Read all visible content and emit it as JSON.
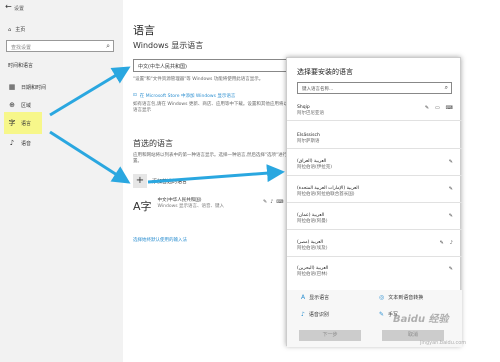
{
  "sidebar": {
    "back_glyph": "←",
    "window_title": "设置",
    "home_label": "主页",
    "search_placeholder": "查找设置",
    "section_label": "时间和语言",
    "items": [
      {
        "label": "日期和时间",
        "icon": "calendar-icon"
      },
      {
        "label": "区域",
        "icon": "globe-icon"
      },
      {
        "label": "语言",
        "icon": "language-icon"
      },
      {
        "label": "语音",
        "icon": "microphone-icon"
      }
    ]
  },
  "main": {
    "title": "语言",
    "display_heading": "Windows 显示语言",
    "display_value": "中文(中华人民共和国)",
    "display_desc": "\"设置\"和\"文件资源管理器\"等 Windows 功能将使用此语言显示。",
    "store_link": "在 Microsoft Store 中添加 Windows 显示语言",
    "store_desc": "如有语言包,请在 Windows 更新、商店、应用等中下载。设置和其他应用将以此语言显示",
    "preferred_heading": "首选的语言",
    "preferred_desc": "应用和网站将以列表中的第一种语言显示。选择一种语言,然后选择\"选项\"进行配置。",
    "add_label": "添加首选的语言",
    "lang_name": "中文(中华人民共和国)",
    "lang_sub": "Windows 显示语言、语音、键入",
    "spell_link": "选择始终默认使用的输入法"
  },
  "dialog": {
    "title": "选择要安装的语言",
    "search_placeholder": "键入语言名称...",
    "languages": [
      {
        "name": "Shqip",
        "sub": "阿尔巴尼亚语"
      },
      {
        "name": "Elsässisch",
        "sub": "阿尔萨斯语"
      },
      {
        "name": "العربية (العراق)",
        "sub": "阿拉伯语(伊拉克)"
      },
      {
        "name": "العربية (الإمارات العربية المتحدة)",
        "sub": "阿拉伯语(阿拉伯联合酋长国)"
      },
      {
        "name": "العربية (عمان)",
        "sub": "阿拉伯语(阿曼)"
      },
      {
        "name": "العربية (مصر)",
        "sub": "阿拉伯语(埃及)"
      },
      {
        "name": "العربية (البحرين)",
        "sub": "阿拉伯语(巴林)"
      }
    ],
    "options": {
      "display_language": "显示语言",
      "tts": "文本到语音转换",
      "speech": "语音识别",
      "handwriting": "手写"
    },
    "next_button": "下一步",
    "cancel_button": "取消"
  },
  "watermark": {
    "logo": "Baidu 经验",
    "url": "jingyan.baidu.com"
  },
  "colors": {
    "accent": "#2a8ed0",
    "arrow": "#2aa7e0",
    "highlight": "#f7f78a"
  }
}
